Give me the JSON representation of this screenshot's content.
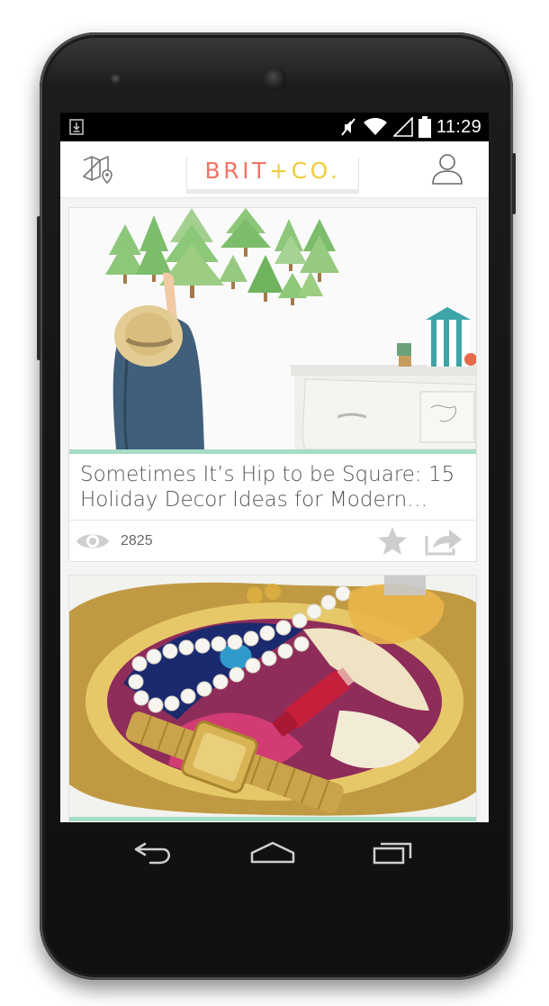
{
  "status_bar": {
    "time": "11:29",
    "icons": [
      "download-notification-icon",
      "mute-icon",
      "wifi-icon",
      "signal-icon",
      "battery-icon"
    ]
  },
  "app_bar": {
    "logo": {
      "part1": "BRIT",
      "part2": "+",
      "part3": "CO."
    },
    "left_icon": "map-icon",
    "right_icon": "profile-icon",
    "colors": {
      "logo_primary": "#ef7466",
      "logo_secondary": "#f0cd3b",
      "accent_line": "#a7dcc4"
    }
  },
  "feed": {
    "cards": [
      {
        "title": "Sometimes It’s Hip to be Square: 15 Holiday Decor Ideas for Modern…",
        "views": "2825",
        "image": "child-decorating-tree-decals"
      },
      {
        "title": "",
        "image": "jewelry-on-gold-tray"
      }
    ]
  },
  "nav_bar": {
    "icons": [
      "back-icon",
      "home-icon",
      "recents-icon"
    ]
  }
}
